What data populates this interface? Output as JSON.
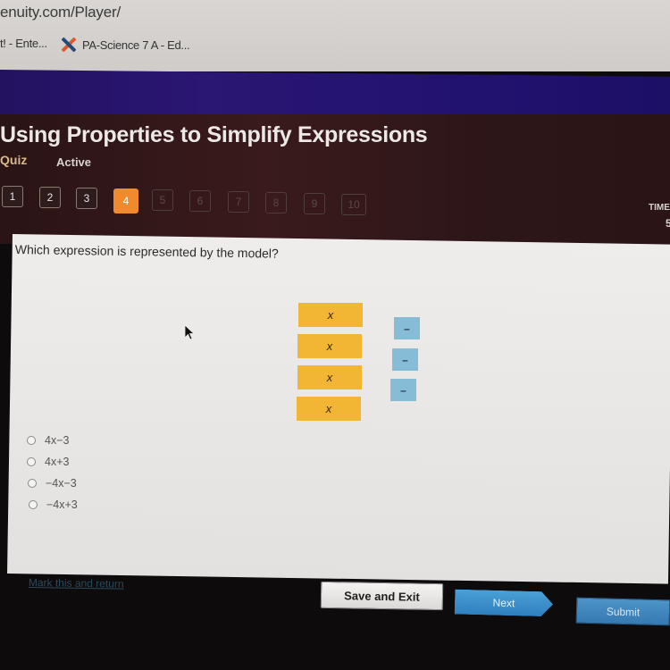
{
  "browser": {
    "url": "enuity.com/Player/",
    "bookmarks": [
      {
        "label": "t! - Ente..."
      },
      {
        "label": "PA-Science 7 A - Ed...",
        "icon": "x-logo-icon"
      }
    ]
  },
  "header": {
    "title": "Using Properties to Simplify Expressions",
    "type": "Quiz",
    "status": "Active",
    "timer_label": "TIME",
    "timer_value": "5"
  },
  "question_nav": [
    {
      "label": "1",
      "state": "answered"
    },
    {
      "label": "2",
      "state": "answered"
    },
    {
      "label": "3",
      "state": "answered"
    },
    {
      "label": "4",
      "state": "current"
    },
    {
      "label": "5",
      "state": "locked"
    },
    {
      "label": "6",
      "state": "locked"
    },
    {
      "label": "7",
      "state": "locked"
    },
    {
      "label": "8",
      "state": "locked"
    },
    {
      "label": "9",
      "state": "locked"
    },
    {
      "label": "10",
      "state": "locked"
    }
  ],
  "question": {
    "prompt": "Which expression is represented by the model?",
    "model": {
      "x_tiles": [
        "x",
        "x",
        "x",
        "x"
      ],
      "negative_unit_tiles": [
        "–",
        "–",
        "–"
      ],
      "x_tile_color": "#f2b534",
      "negative_tile_color": "#86bcd6"
    },
    "options": [
      {
        "label": "4x−3",
        "selected": false
      },
      {
        "label": "4x+3",
        "selected": false
      },
      {
        "label": "−4x−3",
        "selected": false
      },
      {
        "label": "−4x+3",
        "selected": false
      }
    ]
  },
  "footer": {
    "mark_link": "Mark this and return",
    "save_label": "Save and Exit",
    "next_label": "Next",
    "submit_label": "Submit"
  },
  "colors": {
    "current_question": "#f08a2c",
    "primary_button": "#3a8acb",
    "nav_band": "#2a1673"
  }
}
